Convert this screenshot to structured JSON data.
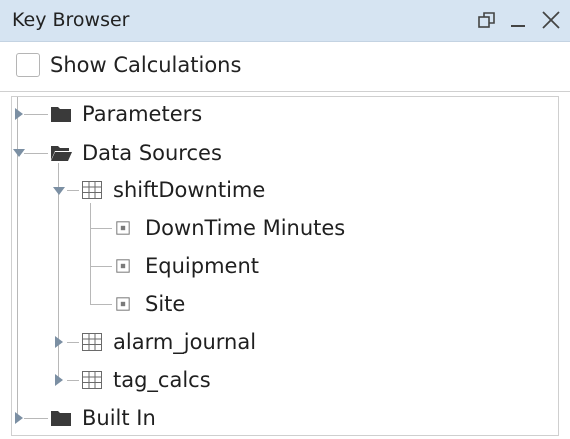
{
  "window": {
    "title": "Key Browser"
  },
  "options": {
    "show_calculations_label": "Show Calculations",
    "show_calculations_checked": false
  },
  "tree": {
    "parameters": "Parameters",
    "data_sources": "Data Sources",
    "shift_downtime": "shiftDowntime",
    "field_downtime_minutes": "DownTime Minutes",
    "field_equipment": "Equipment",
    "field_site": "Site",
    "alarm_journal": "alarm_journal",
    "tag_calcs": "tag_calcs",
    "built_in": "Built In"
  },
  "colors": {
    "titlebar": "#d6e4f2",
    "tree_line": "#b8b8b8",
    "folder": "#3a3a3a",
    "arrow": "#7b8fa3"
  }
}
